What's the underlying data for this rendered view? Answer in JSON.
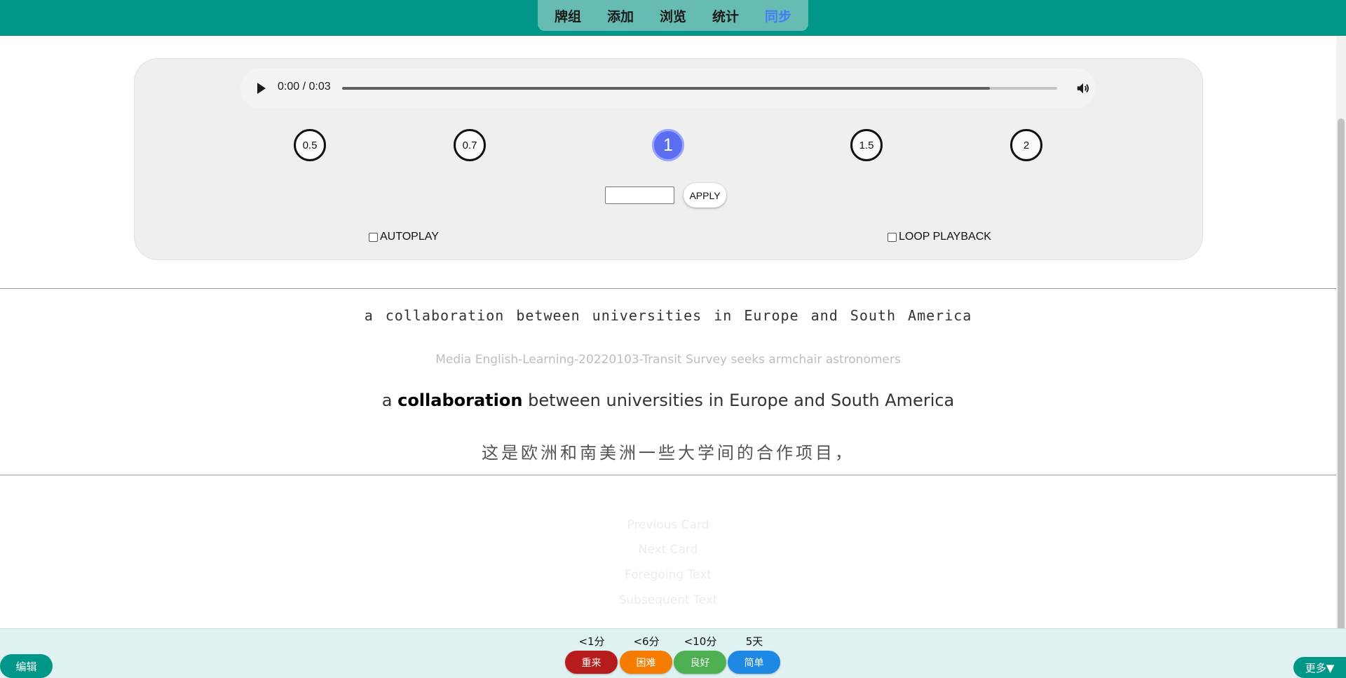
{
  "nav": {
    "tabs": [
      {
        "label": "牌组"
      },
      {
        "label": "添加"
      },
      {
        "label": "浏览"
      },
      {
        "label": "统计"
      },
      {
        "label": "同步"
      }
    ]
  },
  "player": {
    "time": "0:00 / 0:03",
    "progress_fraction": 0.906,
    "speeds": [
      "0.5",
      "0.7",
      "1",
      "1.5",
      "2"
    ],
    "active_speed": "1",
    "rate_input_value": "",
    "apply_label": "APPLY",
    "autoplay_label": "AUTOPLAY",
    "loop_label": "LOOP PLAYBACK"
  },
  "card": {
    "mono_text": "a collaboration between universities in Europe and South America",
    "source": "Media English-Learning-20220103-Transit Survey seeks armchair astronomers",
    "main_prefix": "a",
    "main_keyword": "collaboration",
    "main_suffix": "between universities in Europe and South America",
    "translation": "这是欧洲和南美洲一些大学间的合作项目，"
  },
  "links": {
    "previous": "Previous Card",
    "next": "Next Card",
    "foregoing": "Foregoing Text",
    "subsequent": "Subsequent Text"
  },
  "bottom": {
    "edit_label": "编辑",
    "more_label": "更多▼",
    "ease": [
      {
        "interval": "<1分",
        "label": "重来",
        "color": "#b71c1c"
      },
      {
        "interval": "<6分",
        "label": "困难",
        "color": "#f57c00"
      },
      {
        "interval": "<10分",
        "label": "良好",
        "color": "#4caf50"
      },
      {
        "interval": "5天",
        "label": "简单",
        "color": "#1e88e5"
      }
    ]
  },
  "colors": {
    "accent": "#009688",
    "active_tab": "#3f7ef5",
    "active_speed": "#5b6ef0"
  }
}
